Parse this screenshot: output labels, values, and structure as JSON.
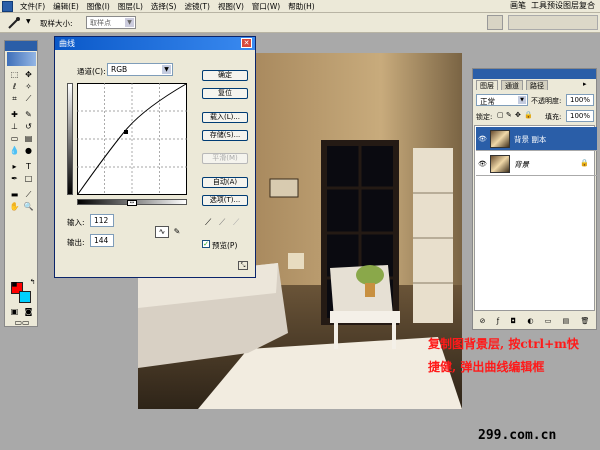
{
  "menubar": {
    "items": [
      "文件(F)",
      "编辑(E)",
      "图像(I)",
      "图层(L)",
      "选择(S)",
      "滤镜(T)",
      "视图(V)",
      "窗口(W)",
      "帮助(H)"
    ]
  },
  "options_bar": {
    "sample_size_label": "取样大小:",
    "sample_size_value": "取样点",
    "well_tabs": [
      "画笔",
      "工具预设",
      "图层复合"
    ]
  },
  "curves_dialog": {
    "title": "曲线",
    "channel_label": "通道(C):",
    "channel_value": "RGB",
    "input_label": "输入:",
    "input_value": "112",
    "output_label": "输出:",
    "output_value": "144",
    "buttons": [
      "确定",
      "复位",
      "载入(L)...",
      "存储(S)...",
      "平滑(M)",
      "自动(A)",
      "选项(T)..."
    ],
    "preview_label": "预览(P)",
    "preview_checked": true
  },
  "layers_palette": {
    "tabs": [
      "图层",
      "通道",
      "路径"
    ],
    "blend_mode": "正常",
    "opacity_label": "不透明度:",
    "opacity_value": "100%",
    "lock_label": "锁定:",
    "fill_label": "填充:",
    "fill_value": "100%",
    "layers": [
      {
        "name": "背景 副本",
        "selected": true
      },
      {
        "name": "背景",
        "selected": false,
        "locked": true
      }
    ]
  },
  "annotation": {
    "line1": "复制图背景层, 按ctrl+m快",
    "line2": "捷健, 弹出曲线编辑框"
  },
  "watermark": "299.com.cn",
  "colors": {
    "foreground": "#ff0000",
    "background": "#00d0ff",
    "selection": "#2a5ea8",
    "annotation": "#ff1a1a"
  }
}
